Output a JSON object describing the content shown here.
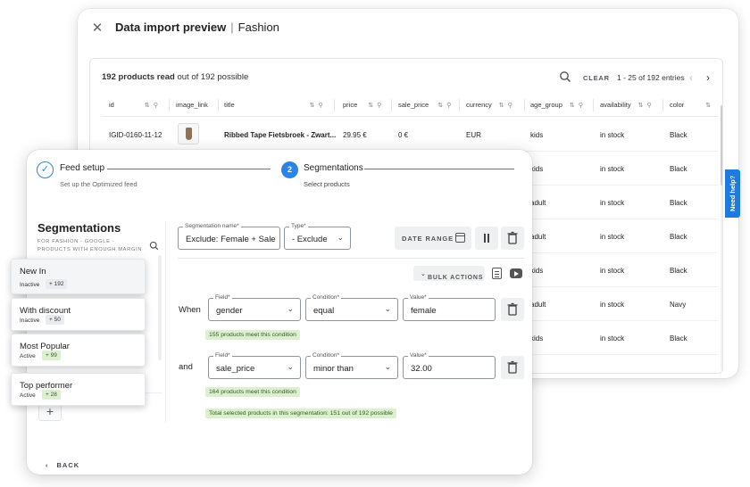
{
  "import_window": {
    "title_bold": "Data import preview",
    "title_sep": "|",
    "title_rest": "Fashion",
    "read_bold": "192 products read",
    "read_rest": "out of 192 possible",
    "clear_label": "CLEAR",
    "entries_label": "1 - 25 of 192 entries",
    "columns": [
      "id",
      "image_link",
      "title",
      "price",
      "sale_price",
      "currency",
      "age_group",
      "availability",
      "color"
    ],
    "rows": [
      {
        "id": "IGID-0160-11-12",
        "title": "Ribbed Tape Fietsbroek - Zwart...",
        "price": "29.95 €",
        "sale_price": "0 €",
        "currency": "EUR",
        "age_group": "kids",
        "availability": "in stock",
        "color": "Black"
      },
      {
        "age_group": "kids",
        "availability": "in stock",
        "color": "Black"
      },
      {
        "age_group": "adult",
        "availability": "in stock",
        "color": "Black"
      },
      {
        "age_group": "adult",
        "availability": "in stock",
        "color": "Black"
      },
      {
        "age_group": "kids",
        "availability": "in stock",
        "color": "Black"
      },
      {
        "age_group": "adult",
        "availability": "in stock",
        "color": "Navy"
      },
      {
        "age_group": "kids",
        "availability": "in stock",
        "color": "Black"
      }
    ]
  },
  "need_help": "Need help?",
  "feed_window": {
    "step1": {
      "title": "Feed setup",
      "subtitle": "Set up the Optimized feed",
      "check": "✓"
    },
    "step2": {
      "number": "2",
      "title": "Segmentations",
      "subtitle": "Select products"
    },
    "segmentations_title": "Segmentations",
    "segmentations_subtitle": "FOR FASHION - GOOGLE - PRODUCTS WITH ENOUGH MARGIN",
    "add_label": "+",
    "back_label": "BACK",
    "segment_name_label": "Segmentation name*",
    "segment_name_value": "Exclude: Female + SaleP",
    "type_label": "Type*",
    "type_value": "- Exclude",
    "date_range_label": "DATE RANGE",
    "bulk_actions_label": "BULK ACTIONS",
    "conditions": [
      {
        "connector": "When",
        "field_label": "Field*",
        "field": "gender",
        "condition_label": "Condition*",
        "condition": "equal",
        "value_label": "Value*",
        "value": "female",
        "meet": "155 products meet this condition"
      },
      {
        "connector": "and",
        "field_label": "Field*",
        "field": "sale_price",
        "condition_label": "Condition*",
        "condition": "minor than",
        "value_label": "Value*",
        "value": "32.00",
        "meet": "164 products meet this condition"
      }
    ],
    "total_selected": "Total selected products in this segmentation: 151 out of 192 possible"
  },
  "segments": [
    {
      "name": "New In",
      "status": "Inactive",
      "count": "+ 192",
      "state": "inactive"
    },
    {
      "name": "With discount",
      "status": "Inactive",
      "count": "+ 50",
      "state": "inactive"
    },
    {
      "name": "Most Popular",
      "status": "Active",
      "count": "+ 99",
      "state": "active"
    },
    {
      "name": "Top performer",
      "status": "Active",
      "count": "+ 28",
      "state": "active"
    }
  ],
  "colors": {
    "accent": "#2a84e5",
    "help_tab": "#1f7ae0",
    "badge_green_bg": "#dcefcf"
  }
}
